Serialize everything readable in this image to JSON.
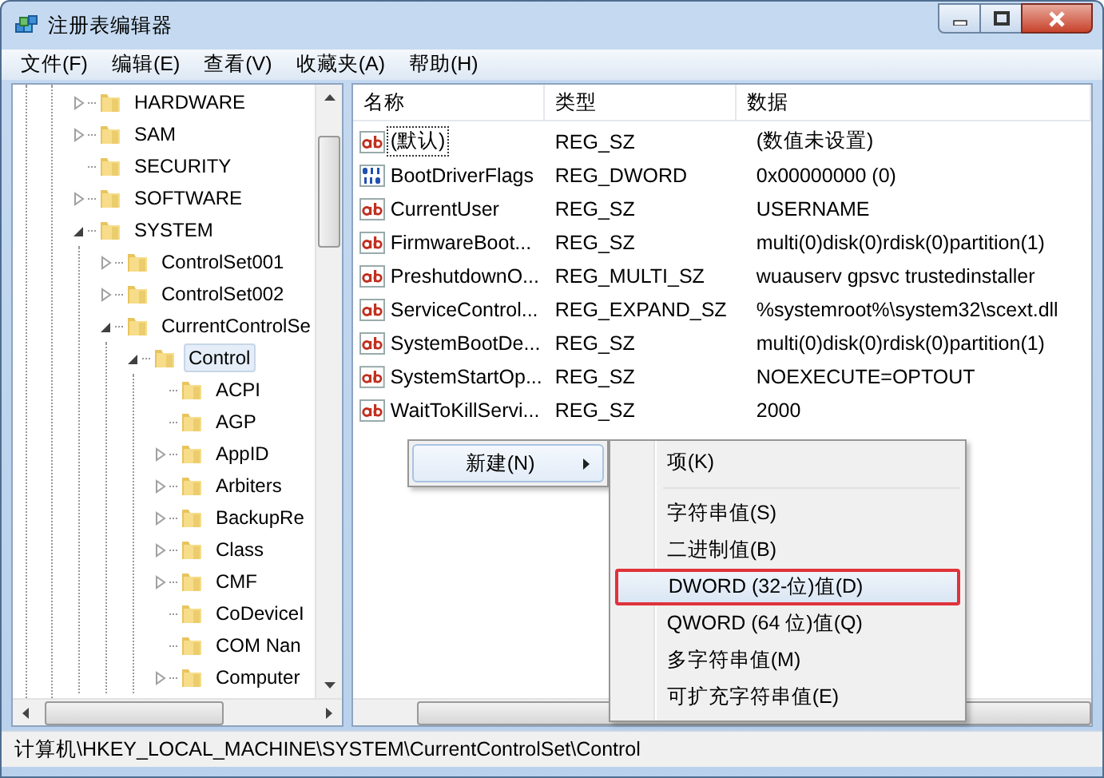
{
  "window": {
    "title": "注册表编辑器"
  },
  "menu_bar": [
    "文件(F)",
    "编辑(E)",
    "查看(V)",
    "收藏夹(A)",
    "帮助(H)"
  ],
  "tree": [
    {
      "label": "HARDWARE",
      "expandable": true,
      "expanded": false,
      "selected": false
    },
    {
      "label": "SAM",
      "expandable": true,
      "expanded": false,
      "selected": false
    },
    {
      "label": "SECURITY",
      "expandable": false,
      "selected": false
    },
    {
      "label": "SOFTWARE",
      "expandable": true,
      "expanded": false,
      "selected": false
    },
    {
      "label": "SYSTEM",
      "expandable": true,
      "expanded": true,
      "selected": false,
      "children": [
        {
          "label": "ControlSet001",
          "expandable": true,
          "expanded": false,
          "selected": false
        },
        {
          "label": "ControlSet002",
          "expandable": true,
          "expanded": false,
          "selected": false
        },
        {
          "label": "CurrentControlSe",
          "expandable": true,
          "expanded": true,
          "selected": false,
          "children": [
            {
              "label": "Control",
              "expandable": true,
              "expanded": true,
              "selected": true,
              "children": [
                {
                  "label": "ACPI",
                  "expandable": false,
                  "selected": false
                },
                {
                  "label": "AGP",
                  "expandable": false,
                  "selected": false
                },
                {
                  "label": "AppID",
                  "expandable": true,
                  "expanded": false,
                  "selected": false
                },
                {
                  "label": "Arbiters",
                  "expandable": true,
                  "expanded": false,
                  "selected": false
                },
                {
                  "label": "BackupRe",
                  "expandable": true,
                  "expanded": false,
                  "selected": false
                },
                {
                  "label": "Class",
                  "expandable": true,
                  "expanded": false,
                  "selected": false
                },
                {
                  "label": "CMF",
                  "expandable": true,
                  "expanded": false,
                  "selected": false
                },
                {
                  "label": "CoDeviceI",
                  "expandable": false,
                  "selected": false
                },
                {
                  "label": "COM Nan",
                  "expandable": false,
                  "selected": false
                },
                {
                  "label": "Computer",
                  "expandable": true,
                  "expanded": false,
                  "selected": false
                }
              ]
            }
          ]
        }
      ]
    }
  ],
  "list": {
    "columns": [
      "名称",
      "类型",
      "数据"
    ],
    "rows": [
      {
        "kind": "string",
        "name": "(默认)",
        "type": "REG_SZ",
        "data": "(数值未设置)",
        "focused": true
      },
      {
        "kind": "binary",
        "name": "BootDriverFlags",
        "type": "REG_DWORD",
        "data": "0x00000000 (0)",
        "focused": false
      },
      {
        "kind": "string",
        "name": "CurrentUser",
        "type": "REG_SZ",
        "data": "USERNAME",
        "focused": false
      },
      {
        "kind": "string",
        "name": "FirmwareBoot...",
        "type": "REG_SZ",
        "data": "multi(0)disk(0)rdisk(0)partition(1)",
        "focused": false
      },
      {
        "kind": "string",
        "name": "PreshutdownO...",
        "type": "REG_MULTI_SZ",
        "data": "wuauserv gpsvc trustedinstaller",
        "focused": false
      },
      {
        "kind": "string",
        "name": "ServiceControl...",
        "type": "REG_EXPAND_SZ",
        "data": "%systemroot%\\system32\\scext.dll",
        "focused": false
      },
      {
        "kind": "string",
        "name": "SystemBootDe...",
        "type": "REG_SZ",
        "data": "multi(0)disk(0)rdisk(0)partition(1)",
        "focused": false
      },
      {
        "kind": "string",
        "name": "SystemStartOp...",
        "type": "REG_SZ",
        "data": " NOEXECUTE=OPTOUT",
        "focused": false
      },
      {
        "kind": "string",
        "name": "WaitToKillServi...",
        "type": "REG_SZ",
        "data": "2000",
        "focused": false
      }
    ]
  },
  "context_menu": {
    "label": "新建(N)",
    "selected": true,
    "submenu": [
      {
        "kind": "item",
        "label": "项(K)",
        "selected": false
      },
      {
        "kind": "separator"
      },
      {
        "kind": "item",
        "label": "字符串值(S)",
        "selected": false
      },
      {
        "kind": "item",
        "label": "二进制值(B)",
        "selected": false
      },
      {
        "kind": "item",
        "label": "DWORD (32-位)值(D)",
        "selected": true
      },
      {
        "kind": "item",
        "label": "QWORD (64 位)值(Q)",
        "selected": false
      },
      {
        "kind": "item",
        "label": "多字符串值(M)",
        "selected": false
      },
      {
        "kind": "item",
        "label": "可扩充字符串值(E)",
        "selected": false
      }
    ]
  },
  "status_bar": {
    "path": "计算机\\HKEY_LOCAL_MACHINE\\SYSTEM\\CurrentControlSet\\Control"
  }
}
